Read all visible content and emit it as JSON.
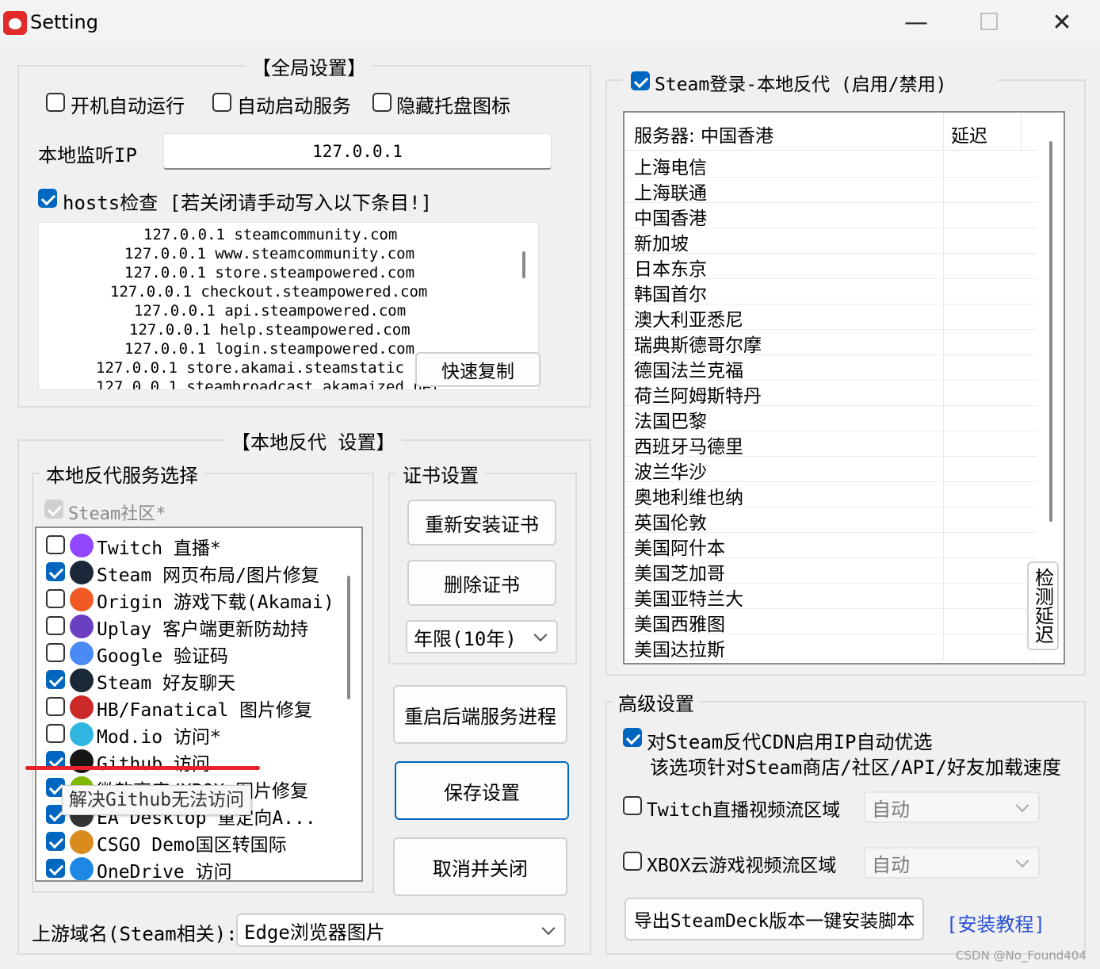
{
  "window": {
    "title": "Setting",
    "minimize_glyph": "—",
    "maximize_glyph": "☐",
    "close_glyph": "✕"
  },
  "global": {
    "group_title": "【全局设置】",
    "autostart_run": "开机自动运行",
    "autostart_service": "自动启动服务",
    "hide_tray_icon": "隐藏托盘图标",
    "listen_ip_label": "本地监听IP",
    "listen_ip_value": "127.0.0.1",
    "hosts_check_label": "hosts检查 [若关闭请手动写入以下条目!]",
    "hosts_lines": [
      "127.0.0.1 steamcommunity.com",
      "127.0.0.1 www.steamcommunity.com",
      "127.0.0.1 store.steampowered.com",
      "127.0.0.1 checkout.steampowered.com",
      "127.0.0.1 api.steampowered.com",
      "127.0.0.1 help.steampowered.com",
      "127.0.0.1 login.steampowered.com",
      "127.0.0.1 store.akamai.steamstatic",
      "127.0.0.1 steambroadcast.akamaized.net"
    ],
    "quick_copy": "快速复制"
  },
  "local_proxy": {
    "group_title": "【本地反代 设置】",
    "service_select_title": "本地反代服务选择",
    "steam_community": "Steam社区*",
    "services": [
      {
        "label": "Twitch 直播*",
        "checked": false,
        "icon": "twitch-icon",
        "color": "#9146ff"
      },
      {
        "label": "Steam 网页布局/图片修复",
        "checked": true,
        "icon": "steam-icon",
        "color": "#1b2838"
      },
      {
        "label": "Origin 游戏下载(Akamai)",
        "checked": false,
        "icon": "origin-icon",
        "color": "#f15a24"
      },
      {
        "label": "Uplay 客户端更新防劫持",
        "checked": false,
        "icon": "uplay-icon",
        "color": "#6a3fc1"
      },
      {
        "label": "Google 验证码",
        "checked": false,
        "icon": "google-icon",
        "color": "#4a8af4"
      },
      {
        "label": "Steam 好友聊天",
        "checked": true,
        "icon": "steam-icon",
        "color": "#1b2838"
      },
      {
        "label": "HB/Fanatical 图片修复",
        "checked": false,
        "icon": "humble-icon",
        "color": "#cc2929"
      },
      {
        "label": "Mod.io 访问*",
        "checked": false,
        "icon": "modio-icon",
        "color": "#2fb6e0"
      },
      {
        "label": "Github 访问",
        "checked": true,
        "icon": "github-icon",
        "color": "#161616"
      },
      {
        "label": "微软商店/XBOX 图片修复",
        "checked": true,
        "icon": "microsoft-icon",
        "color": "#7fba00"
      },
      {
        "label": "EA Desktop 重定向A...",
        "checked": true,
        "icon": "ea-icon",
        "color": "#333333"
      },
      {
        "label": "CSGO Demo国区转国际",
        "checked": true,
        "icon": "csgo-icon",
        "color": "#d98b1d"
      },
      {
        "label": "OneDrive 访问",
        "checked": true,
        "icon": "onedrive-icon",
        "color": "#1e88e5"
      }
    ],
    "tooltip": "解决Github无法访问",
    "cert_title": "证书设置",
    "reinstall_cert": "重新安装证书",
    "delete_cert": "删除证书",
    "cert_years": "年限(10年)",
    "restart_backend": "重启后端服务进程",
    "save_settings": "保存设置",
    "cancel_close": "取消并关闭",
    "upstream_label": "上游域名(Steam相关):",
    "upstream_value": "Edge浏览器图片"
  },
  "steam_login": {
    "title": "Steam登录-本地反代 (启用/禁用)",
    "header_server": "服务器: 中国香港",
    "header_latency": "延迟",
    "servers": [
      "上海电信",
      "上海联通",
      "中国香港",
      "新加坡",
      "日本东京",
      "韩国首尔",
      "澳大利亚悉尼",
      "瑞典斯德哥尔摩",
      "德国法兰克福",
      "荷兰阿姆斯特丹",
      "法国巴黎",
      "西班牙马德里",
      "波兰华沙",
      "奥地利维也纳",
      "英国伦敦",
      "美国阿什本",
      "美国芝加哥",
      "美国亚特兰大",
      "美国西雅图",
      "美国达拉斯"
    ],
    "detect_latency": "检测延迟"
  },
  "advanced": {
    "title": "高级设置",
    "cdn_auto": "对Steam反代CDN启用IP自动优选",
    "cdn_note": "该选项针对Steam商店/社区/API/好友加载速度",
    "twitch_region": "Twitch直播视频流区域",
    "twitch_value": "自动",
    "xbox_region": "XBOX云游戏视频流区域",
    "xbox_value": "自动",
    "export_script": "导出SteamDeck版本一键安装脚本",
    "install_tutorial": "[安装教程]"
  },
  "watermark": "CSDN @No_Found404",
  "colors": {
    "accent": "#0067c0",
    "annotation_red": "#e8202a",
    "link": "#2b52d6"
  }
}
